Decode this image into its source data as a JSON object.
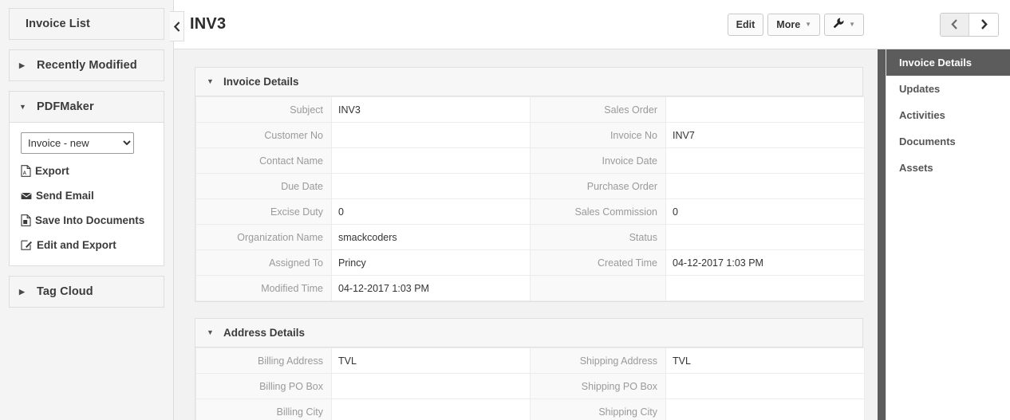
{
  "left_sidebar": {
    "list_title": "Invoice List",
    "sections": [
      {
        "label": "Recently Modified",
        "caret": "collapsed-caret-icon",
        "expanded": false
      },
      {
        "label": "PDFMaker",
        "caret": "expanded-caret-icon",
        "expanded": true
      },
      {
        "label": "Tag Cloud",
        "caret": "collapsed-caret-icon",
        "expanded": false
      }
    ],
    "pdfmaker": {
      "template_selected": "Invoice - new",
      "template_options": [
        "Invoice - new"
      ],
      "actions": [
        {
          "label": "Export",
          "icon": "pdf-file-icon"
        },
        {
          "label": "Send Email",
          "icon": "envelope-icon"
        },
        {
          "label": "Save Into Documents",
          "icon": "save-document-icon"
        },
        {
          "label": "Edit and Export",
          "icon": "edit-square-icon"
        }
      ]
    },
    "collapse_handle_icon": "chevron-left-icon"
  },
  "header": {
    "title": "INV3",
    "edit_label": "Edit",
    "more_label": "More",
    "more_caret_icon": "caret-down-icon",
    "tools_icon": "wrench-icon",
    "tools_caret_icon": "caret-down-icon",
    "prev_icon": "chevron-left-icon",
    "next_icon": "chevron-right-icon"
  },
  "blocks": [
    {
      "title": "Invoice Details",
      "caret": "expanded-caret-icon",
      "rows": [
        {
          "label1": "Subject",
          "value1": "INV3",
          "label2": "Sales Order",
          "value2": ""
        },
        {
          "label1": "Customer No",
          "value1": "",
          "label2": "Invoice No",
          "value2": "INV7"
        },
        {
          "label1": "Contact Name",
          "value1": "",
          "label2": "Invoice Date",
          "value2": ""
        },
        {
          "label1": "Due Date",
          "value1": "",
          "label2": "Purchase Order",
          "value2": ""
        },
        {
          "label1": "Excise Duty",
          "value1": "0",
          "label2": "Sales Commission",
          "value2": "0"
        },
        {
          "label1": "Organization Name",
          "value1": "smackcoders",
          "label2": "Status",
          "value2": ""
        },
        {
          "label1": "Assigned To",
          "value1": "Princy",
          "label2": "Created Time",
          "value2": "04-12-2017 1:03 PM"
        },
        {
          "label1": "Modified Time",
          "value1": "04-12-2017 1:03 PM",
          "label2": "",
          "value2": ""
        }
      ]
    },
    {
      "title": "Address Details",
      "caret": "expanded-caret-icon",
      "rows": [
        {
          "label1": "Billing Address",
          "value1": "TVL",
          "label2": "Shipping Address",
          "value2": "TVL"
        },
        {
          "label1": "Billing PO Box",
          "value1": "",
          "label2": "Shipping PO Box",
          "value2": ""
        },
        {
          "label1": "Billing City",
          "value1": "",
          "label2": "Shipping City",
          "value2": ""
        }
      ]
    }
  ],
  "right_panel": {
    "items": [
      {
        "label": "Invoice Details",
        "active": true
      },
      {
        "label": "Updates",
        "active": false
      },
      {
        "label": "Activities",
        "active": false
      },
      {
        "label": "Documents",
        "active": false
      },
      {
        "label": "Assets",
        "active": false
      }
    ]
  },
  "colors": {
    "active_panel_bg": "#5c5c5c",
    "page_bg": "#f2f2f2",
    "sidebar_bg": "#f4f4f4",
    "label_text": "#9a9a9a"
  }
}
